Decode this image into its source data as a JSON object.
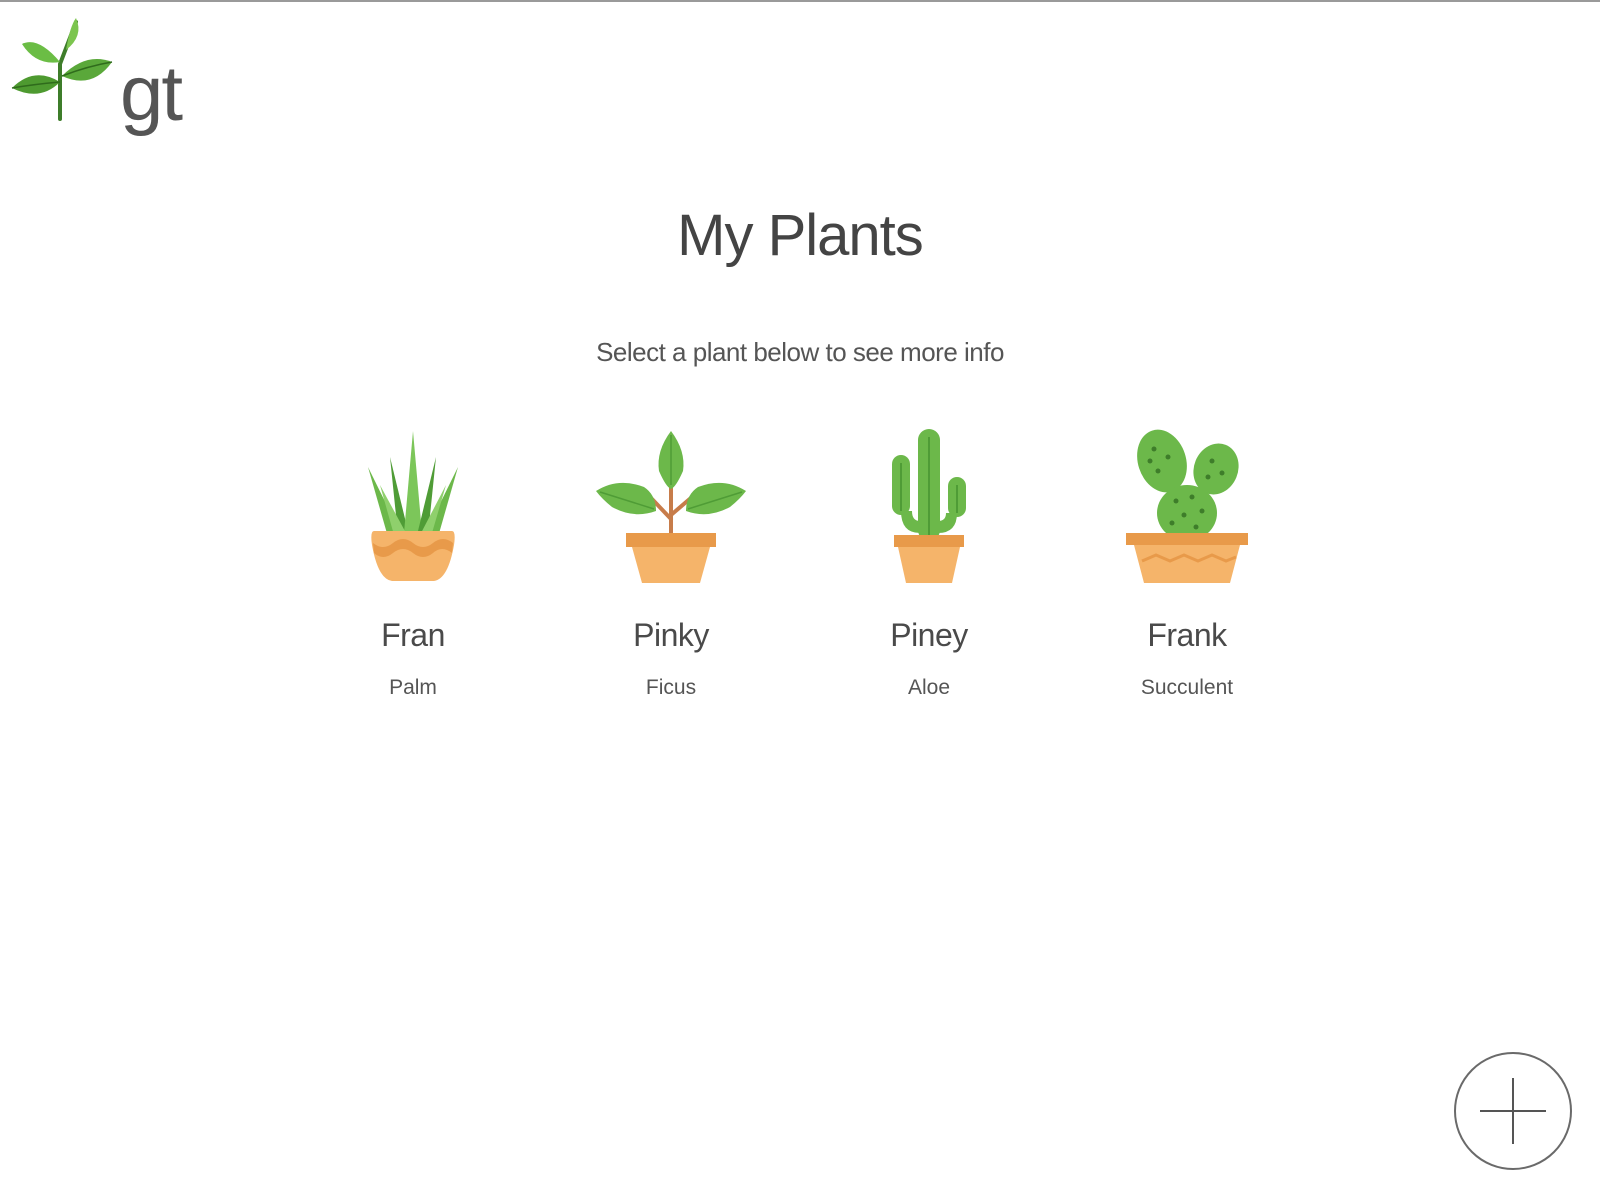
{
  "app": {
    "logo_text": "gt",
    "logo_icon": "sprout-leaf-icon",
    "accent_color": "#4caf50"
  },
  "header": {
    "title": "My Plants",
    "subtitle": "Select a plant below to see more info"
  },
  "plants": [
    {
      "name": "Fran",
      "type": "Palm",
      "icon": "palm-plant-icon"
    },
    {
      "name": "Pinky",
      "type": "Ficus",
      "icon": "ficus-plant-icon"
    },
    {
      "name": "Piney",
      "type": "Aloe",
      "icon": "aloe-plant-icon"
    },
    {
      "name": "Frank",
      "type": "Succulent",
      "icon": "cactus-plant-icon"
    }
  ],
  "actions": {
    "add_icon": "plus-icon"
  }
}
